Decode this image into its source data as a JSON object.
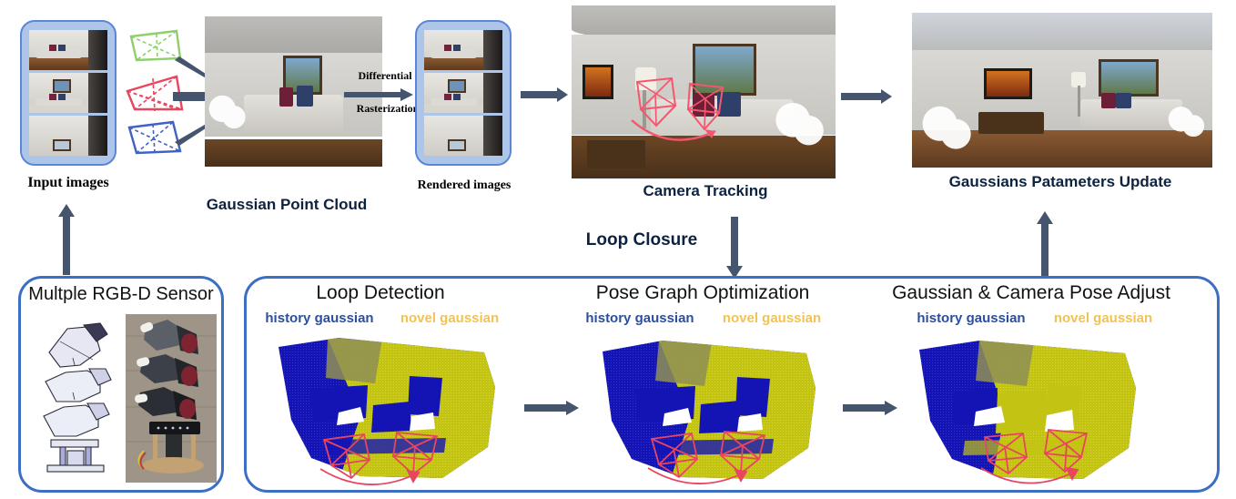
{
  "pipeline": {
    "top": {
      "input_images_label": "Input images",
      "gaussian_point_cloud_label": "Gaussian Point Cloud",
      "differential_label": "Differential",
      "rasterization_label": "Rasterization",
      "rendered_images_label": "Rendered  images",
      "camera_tracking_label": "Camera Tracking",
      "gaussians_update_label": "Gaussians Patameters Update"
    },
    "loop_closure_label": "Loop Closure",
    "sensor_panel": {
      "title": "Multple RGB-D Sensor"
    },
    "bottom_stages": [
      {
        "title": "Loop Detection",
        "legend_history": "history gaussian",
        "legend_novel": "novel gaussian"
      },
      {
        "title": "Pose Graph Optimization",
        "legend_history": "history gaussian",
        "legend_novel": "novel gaussian"
      },
      {
        "title": "Gaussian & Camera Pose Adjust",
        "legend_history": "history gaussian",
        "legend_novel": "novel gaussian"
      }
    ]
  },
  "colors": {
    "frame_border": "#3b6fc4",
    "stack_fill": "#aec5ea",
    "arrow": "#46556e",
    "history_gaussian": "#2b4f9e",
    "novel_gaussian": "#f2c351",
    "point_blue": "#1414b4",
    "point_yellow": "#c8c814",
    "camera_frustum": "#f4566e",
    "frustum_green": "#8ed06a",
    "frustum_red": "#e8455e",
    "frustum_blue": "#3f62c4"
  },
  "icons": {
    "camera_frustum_green": "camera-frustum-green-icon",
    "camera_frustum_red": "camera-frustum-red-icon",
    "camera_frustum_blue": "camera-frustum-blue-icon",
    "arrow_right": "arrow-right-icon",
    "arrow_up": "arrow-up-icon",
    "arrow_down": "arrow-down-icon"
  }
}
